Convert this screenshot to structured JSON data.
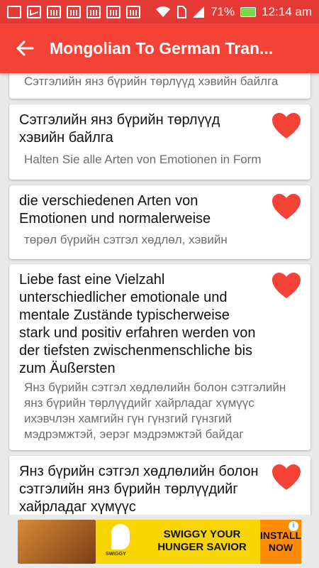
{
  "status_bar": {
    "battery": "71%",
    "time": "12:14 am"
  },
  "app_bar": {
    "title": "Mongolian To German Tran..."
  },
  "items": [
    {
      "source": "",
      "translation": "Сэтгэлийн янз бүрийн төрлүүд хэвийн байлга"
    },
    {
      "source": "Сэтгэлийн янз бүрийн төрлүүд хэвийн байлга",
      "translation": "Halten Sie alle Arten von Emotionen in Form"
    },
    {
      "source": "die verschiedenen Arten von Emotionen und normalerweise",
      "translation": "төрөл бүрийн сэтгэл хөдлөл, хэвийн"
    },
    {
      "source": "Liebe fast eine Vielzahl unterschiedlicher emotionale und mentale Zustände typischerweise stark und positiv erfahren werden von der tiefsten zwischenmenschliche bis zum Äußersten",
      "translation": "Янз бүрийн сэтгэл хөдлөлийн болон сэтгэлийн янз бүрийн төрлүүдийг хайрладаг хүмүүс ихэвчлэн хамгийн гүн гүнзгий гүнзгий мэдрэмжтэй, эерэг мэдрэмжтэй байдаг"
    },
    {
      "source": "Янз бүрийн сэтгэл хөдлөлийн болон сэтгэлийн янз бүрийн төрлүүдийг хайрладаг хүмүүс",
      "translation": ""
    }
  ],
  "ad": {
    "brand": "SWIGGY",
    "slogan": "SWIGGY YOUR HUNGER SAVIOR",
    "install": "INSTALL NOW",
    "info": "i"
  },
  "colors": {
    "primary": "#f44336",
    "status_bar": "#e53935",
    "heart": "#f44336"
  }
}
